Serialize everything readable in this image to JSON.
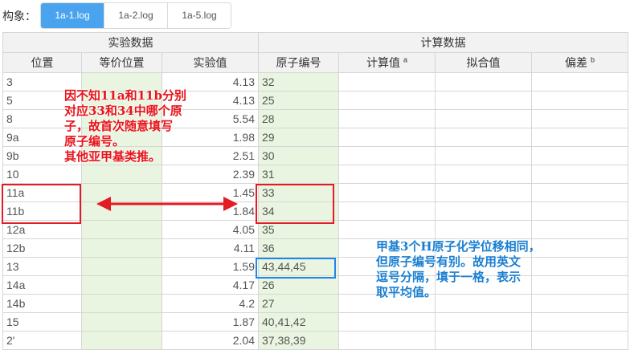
{
  "toolbar": {
    "label": "构象：",
    "tabs": [
      "1a-1.log",
      "1a-2.log",
      "1a-5.log"
    ],
    "active_tab": 0
  },
  "table": {
    "group_headers": [
      "实验数据",
      "计算数据"
    ],
    "columns": [
      "位置",
      "等价位置",
      "实验值",
      "原子编号",
      "计算值",
      "拟合值",
      "偏差"
    ],
    "column_sups": [
      "",
      "",
      "",
      "",
      "a",
      "",
      "b"
    ],
    "rows": [
      [
        "3",
        "",
        "4.13",
        "32",
        "",
        "",
        ""
      ],
      [
        "5",
        "",
        "4.13",
        "25",
        "",
        "",
        ""
      ],
      [
        "8",
        "",
        "5.54",
        "28",
        "",
        "",
        ""
      ],
      [
        "9a",
        "",
        "1.98",
        "29",
        "",
        "",
        ""
      ],
      [
        "9b",
        "",
        "2.51",
        "30",
        "",
        "",
        ""
      ],
      [
        "10",
        "",
        "2.39",
        "31",
        "",
        "",
        ""
      ],
      [
        "11a",
        "",
        "1.45",
        "33",
        "",
        "",
        ""
      ],
      [
        "11b",
        "",
        "1.84",
        "34",
        "",
        "",
        ""
      ],
      [
        "12a",
        "",
        "4.05",
        "35",
        "",
        "",
        ""
      ],
      [
        "12b",
        "",
        "4.11",
        "36",
        "",
        "",
        ""
      ],
      [
        "13",
        "",
        "1.59",
        "43,44,45",
        "",
        "",
        ""
      ],
      [
        "14a",
        "",
        "4.17",
        "26",
        "",
        "",
        ""
      ],
      [
        "14b",
        "",
        "4.2",
        "27",
        "",
        "",
        ""
      ],
      [
        "15",
        "",
        "1.87",
        "40,41,42",
        "",
        "",
        ""
      ],
      [
        "2'",
        "",
        "2.04",
        "37,38,39",
        "",
        "",
        ""
      ]
    ]
  },
  "annotations": {
    "red_note": [
      "因不知11a和11b分别",
      "对应33和34中哪个原",
      "子，故首次随意填写",
      "原子编号。",
      "其他亚甲基类推。"
    ],
    "blue_note": [
      "甲基3个H原子化学位移相同，",
      "但原子编号有别。故用英文",
      "逗号分隔，填于一格，表示",
      "取平均值。"
    ]
  },
  "colors": {
    "tab_active": "#4aa3ee",
    "editable_cell": "#eaf5e1",
    "annotation_red": "#e31c23",
    "annotation_blue": "#1e88e5"
  }
}
